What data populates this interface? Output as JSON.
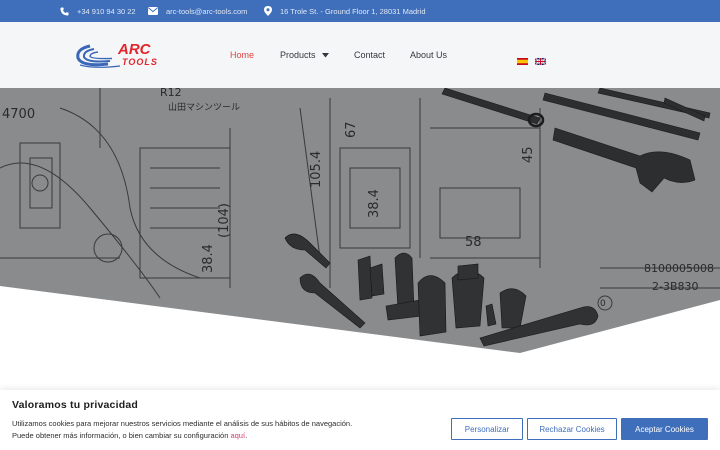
{
  "topbar": {
    "phone": "+34 910 94 30 22",
    "email": "arc-tools@arc-tools.com",
    "address": "16 Trole St. - Ground Floor 1, 28031 Madrid"
  },
  "logo": {
    "line1": "ARC",
    "line2": "TOOLS"
  },
  "nav": {
    "home": "Home",
    "products": "Products",
    "contact": "Contact",
    "about": "About Us"
  },
  "hero": {
    "drawing_labels": [
      "4700",
      "R12",
      "105.4",
      "67",
      "38.4",
      "(104)",
      "38.4",
      "58",
      "45",
      "8100005008",
      "2-3B830",
      "山田マシンツール",
      "0"
    ]
  },
  "cookie": {
    "title": "Valoramos tu privacidad",
    "line1": "Utilizamos cookies para mejorar nuestros servicios mediante el análisis de sus hábitos de navegación.",
    "line2_prefix": "Puede obtener más información, o bien cambiar su configuración ",
    "link": "aquí",
    "line2_suffix": ".",
    "buttons": {
      "customize": "Personalizar",
      "reject": "Rechazar Cookies",
      "accept": "Aceptar Cookies"
    }
  },
  "colors": {
    "brand_blue": "#3f6fba",
    "accent_red": "#e2423f",
    "link_pink": "#d9386b",
    "hero_gray": "#8a8b8d"
  },
  "icons": [
    "phone-icon",
    "envelope-icon",
    "map-marker-icon",
    "chevron-down-icon",
    "flag-es-icon",
    "flag-gb-icon"
  ]
}
